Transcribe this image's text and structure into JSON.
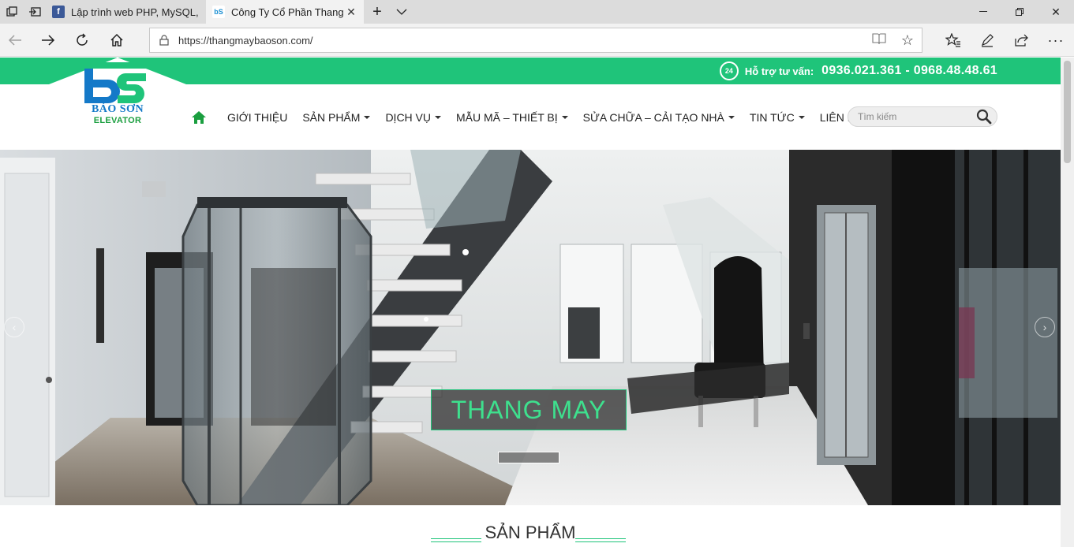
{
  "browser": {
    "tabs": [
      {
        "title": "Lập trình web PHP, MySQL,",
        "favicon": "f"
      },
      {
        "title": "Công Ty Cổ Phần Thang",
        "favicon": "bS"
      }
    ],
    "url": "https://thangmaybaoson.com/"
  },
  "site": {
    "support_label": "Hỗ trợ tư vấn:",
    "support_phones": "0936.021.361 - 0968.48.48.61",
    "support_badge": "24",
    "logo_name": "BẢO SƠN",
    "logo_sub": "ELEVATOR",
    "menu": [
      {
        "label": "GIỚI THIỆU",
        "dropdown": false
      },
      {
        "label": "SẢN PHẨM",
        "dropdown": true
      },
      {
        "label": "DỊCH VỤ",
        "dropdown": true
      },
      {
        "label": "MẪU MÃ – THIẾT BỊ",
        "dropdown": true
      },
      {
        "label": "SỬA CHỮA – CẢI TẠO NHÀ",
        "dropdown": true
      },
      {
        "label": "TIN TỨC",
        "dropdown": true
      },
      {
        "label": "LIÊN HỆ",
        "dropdown": false
      }
    ],
    "search_placeholder": "Tìm kiếm",
    "hero_caption": "THANG MAY",
    "section_title": "SẢN PHẨM"
  },
  "colors": {
    "brand_green": "#1fc47a",
    "logo_blue": "#1479c8",
    "caption_green": "#3ee08e"
  }
}
